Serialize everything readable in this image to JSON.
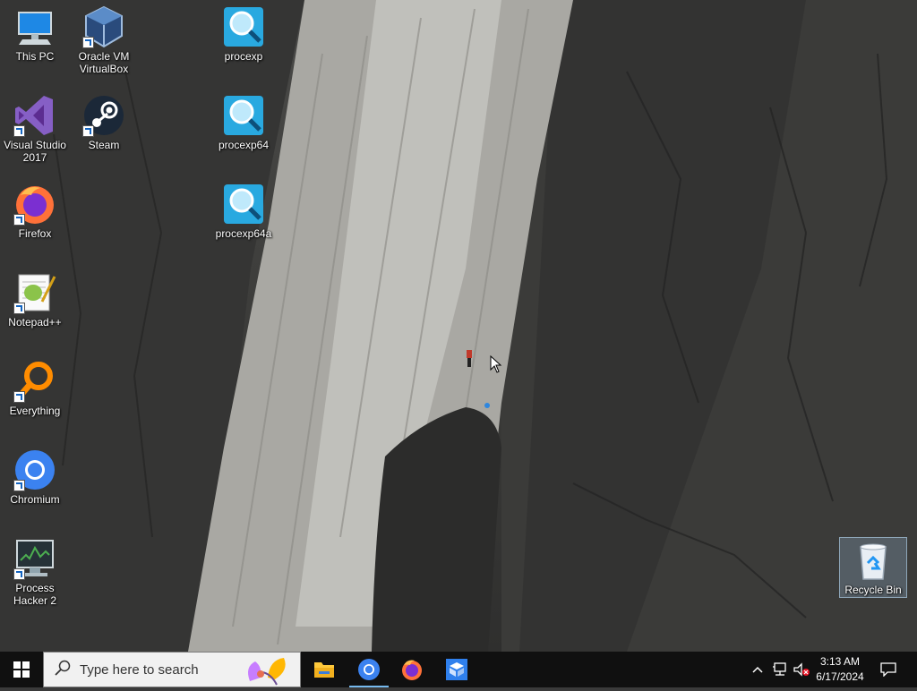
{
  "desktop": {
    "icons": [
      {
        "label": "This PC"
      },
      {
        "label": "Oracle VM\nVirtualBox"
      },
      {
        "label": "procexp"
      },
      {
        "label": "Visual Studio\n2017"
      },
      {
        "label": "Steam"
      },
      {
        "label": "procexp64"
      },
      {
        "label": "Firefox"
      },
      {
        "label": "procexp64a"
      },
      {
        "label": "Notepad++"
      },
      {
        "label": "Everything"
      },
      {
        "label": "Chromium"
      },
      {
        "label": "Process\nHacker 2"
      }
    ],
    "recycle_bin": {
      "label": "Recycle Bin"
    }
  },
  "taskbar": {
    "search_placeholder": "Type here to search",
    "pinned_apps": [
      "file-explorer",
      "chromium",
      "firefox",
      "virtualbox"
    ],
    "clock": {
      "time": "3:13 AM",
      "date": "6/17/2024"
    }
  },
  "colors": {
    "taskbar": "#101010",
    "accent": "#76b9ed"
  }
}
